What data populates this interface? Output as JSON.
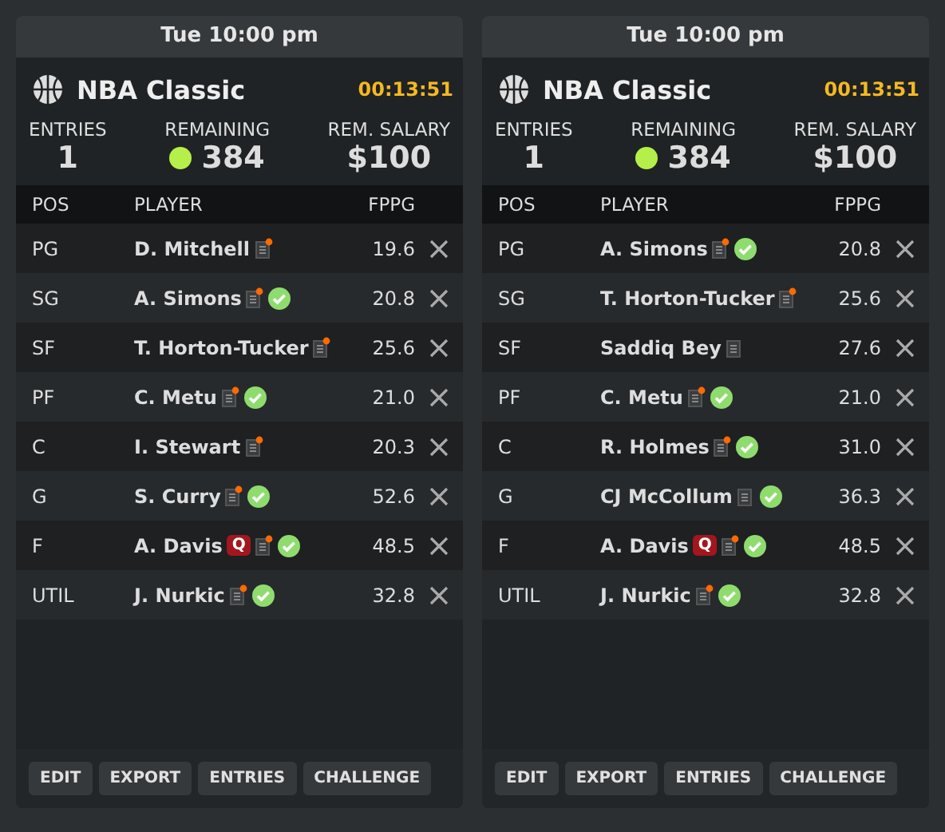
{
  "cards": [
    {
      "time": "Tue 10:00 pm",
      "title": "NBA Classic",
      "countdown": "00:13:51",
      "stats": [
        {
          "label": "ENTRIES",
          "value": "1",
          "kind": "plain"
        },
        {
          "label": "REMAINING",
          "value": "384",
          "kind": "dot",
          "color": "#b5f04a"
        },
        {
          "label": "REM. SALARY",
          "value": "$100",
          "kind": "plain"
        }
      ],
      "columns": [
        "POS",
        "PLAYER",
        "FPPG"
      ],
      "rows": [
        {
          "pos": "PG",
          "player": "D. Mitchell",
          "fppg": "19.6",
          "news": true,
          "confirmed": false
        },
        {
          "pos": "SG",
          "player": "A. Simons",
          "fppg": "20.8",
          "news": true,
          "confirmed": true
        },
        {
          "pos": "SF",
          "player": "T. Horton-Tucker",
          "fppg": "25.6",
          "news": true,
          "confirmed": false
        },
        {
          "pos": "PF",
          "player": "C. Metu",
          "fppg": "21.0",
          "news": true,
          "confirmed": true
        },
        {
          "pos": "C",
          "player": "I. Stewart",
          "fppg": "20.3",
          "news": true,
          "confirmed": false
        },
        {
          "pos": "G",
          "player": "S. Curry",
          "fppg": "52.6",
          "news": true,
          "confirmed": true
        },
        {
          "pos": "F",
          "player": "A. Davis",
          "injury": "Q",
          "fppg": "48.5",
          "news": true,
          "confirmed": true
        },
        {
          "pos": "UTIL",
          "player": "J. Nurkic",
          "fppg": "32.8",
          "news": true,
          "confirmed": true
        }
      ],
      "buttons": [
        "EDIT",
        "EXPORT",
        "ENTRIES",
        "CHALLENGE"
      ]
    },
    {
      "time": "Tue 10:00 pm",
      "title": "NBA Classic",
      "countdown": "00:13:51",
      "stats": [
        {
          "label": "ENTRIES",
          "value": "1",
          "kind": "plain"
        },
        {
          "label": "REMAINING",
          "value": "384",
          "kind": "dot",
          "color": "#b5f04a"
        },
        {
          "label": "REM. SALARY",
          "value": "$100",
          "kind": "plain"
        }
      ],
      "columns": [
        "POS",
        "PLAYER",
        "FPPG"
      ],
      "rows": [
        {
          "pos": "PG",
          "player": "A. Simons",
          "fppg": "20.8",
          "news": true,
          "confirmed": true
        },
        {
          "pos": "SG",
          "player": "T. Horton-Tucker",
          "fppg": "25.6",
          "news": true,
          "confirmed": false
        },
        {
          "pos": "SF",
          "player": "Saddiq Bey",
          "fppg": "27.6",
          "news": false,
          "confirmed": false
        },
        {
          "pos": "PF",
          "player": "C. Metu",
          "fppg": "21.0",
          "news": true,
          "confirmed": true
        },
        {
          "pos": "C",
          "player": "R. Holmes",
          "fppg": "31.0",
          "news": true,
          "confirmed": true
        },
        {
          "pos": "G",
          "player": "CJ McCollum",
          "fppg": "36.3",
          "news": false,
          "confirmed": true
        },
        {
          "pos": "F",
          "player": "A. Davis",
          "injury": "Q",
          "fppg": "48.5",
          "news": true,
          "confirmed": true
        },
        {
          "pos": "UTIL",
          "player": "J. Nurkic",
          "fppg": "32.8",
          "news": true,
          "confirmed": true
        }
      ],
      "buttons": [
        "EDIT",
        "EXPORT",
        "ENTRIES",
        "CHALLENGE"
      ]
    }
  ]
}
